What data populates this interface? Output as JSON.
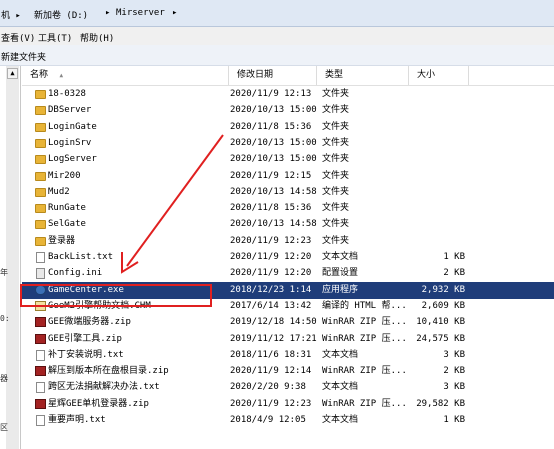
{
  "breadcrumb": {
    "items": [
      "机 ▸",
      "新加卷 (D:)",
      "▸",
      "Mirserver",
      "▸"
    ]
  },
  "menubar": {
    "items": [
      "查看(V)",
      "工具(T)",
      "帮助(H)"
    ]
  },
  "toolbar": {
    "new_folder": "新建文件夹"
  },
  "left_fragments": [
    "年",
    "0:",
    "器",
    "区"
  ],
  "columns": {
    "name": "名称",
    "date": "修改日期",
    "type": "类型",
    "size": "大小",
    "sort_indicator": "▲"
  },
  "files": [
    {
      "icon": "folder-icon",
      "name": "18-0328",
      "date": "2020/11/9 12:13",
      "type": "文件夹",
      "size": ""
    },
    {
      "icon": "folder-icon",
      "name": "DBServer",
      "date": "2020/10/13 15:00",
      "type": "文件夹",
      "size": ""
    },
    {
      "icon": "folder-icon",
      "name": "LoginGate",
      "date": "2020/11/8 15:36",
      "type": "文件夹",
      "size": ""
    },
    {
      "icon": "folder-icon",
      "name": "LoginSrv",
      "date": "2020/10/13 15:00",
      "type": "文件夹",
      "size": ""
    },
    {
      "icon": "folder-icon",
      "name": "LogServer",
      "date": "2020/10/13 15:00",
      "type": "文件夹",
      "size": ""
    },
    {
      "icon": "folder-icon",
      "name": "Mir200",
      "date": "2020/11/9 12:15",
      "type": "文件夹",
      "size": ""
    },
    {
      "icon": "folder-icon",
      "name": "Mud2",
      "date": "2020/10/13 14:58",
      "type": "文件夹",
      "size": ""
    },
    {
      "icon": "folder-icon",
      "name": "RunGate",
      "date": "2020/11/8 15:36",
      "type": "文件夹",
      "size": ""
    },
    {
      "icon": "folder-icon",
      "name": "SelGate",
      "date": "2020/10/13 14:58",
      "type": "文件夹",
      "size": ""
    },
    {
      "icon": "folder-icon",
      "name": "登录器",
      "date": "2020/11/9 12:23",
      "type": "文件夹",
      "size": ""
    },
    {
      "icon": "text-file-icon",
      "name": "BackList.txt",
      "date": "2020/11/9 12:20",
      "type": "文本文档",
      "size": "1 KB"
    },
    {
      "icon": "config-file-icon",
      "name": "Config.ini",
      "date": "2020/11/9 12:20",
      "type": "配置设置",
      "size": "2 KB"
    },
    {
      "icon": "exe-icon",
      "name": "GameCenter.exe",
      "date": "2018/12/23 1:14",
      "type": "应用程序",
      "size": "2,932 KB",
      "selected": true
    },
    {
      "icon": "chm-icon",
      "name": "GeeM2引擎帮助文档.CHM",
      "date": "2017/6/14 13:42",
      "type": "编译的 HTML 帮...",
      "size": "2,609 KB"
    },
    {
      "icon": "winrar-icon",
      "name": "GEE微端服务器.zip",
      "date": "2019/12/18 14:50",
      "type": "WinRAR ZIP 压...",
      "size": "10,410 KB"
    },
    {
      "icon": "winrar-icon",
      "name": "GEE引擎工具.zip",
      "date": "2019/11/12 17:21",
      "type": "WinRAR ZIP 压...",
      "size": "24,575 KB"
    },
    {
      "icon": "text-file-icon",
      "name": "补丁安装说明.txt",
      "date": "2018/11/6 18:31",
      "type": "文本文档",
      "size": "3 KB"
    },
    {
      "icon": "winrar-icon",
      "name": "解压到版本所在盘根目录.zip",
      "date": "2020/11/9 12:14",
      "type": "WinRAR ZIP 压...",
      "size": "2 KB"
    },
    {
      "icon": "text-file-icon",
      "name": "跨区无法捐献解决办法.txt",
      "date": "2020/2/20 9:38",
      "type": "文本文档",
      "size": "3 KB"
    },
    {
      "icon": "winrar-icon",
      "name": "星辉GEE单机登录器.zip",
      "date": "2020/11/9 12:23",
      "type": "WinRAR ZIP 压...",
      "size": "29,582 KB"
    },
    {
      "icon": "text-file-icon",
      "name": "重要声明.txt",
      "date": "2018/4/9 12:05",
      "type": "文本文档",
      "size": "1 KB"
    }
  ],
  "colors": {
    "selection_bg": "#1f3d7a",
    "annotation": "#e02020",
    "folder": "#e8b437"
  }
}
